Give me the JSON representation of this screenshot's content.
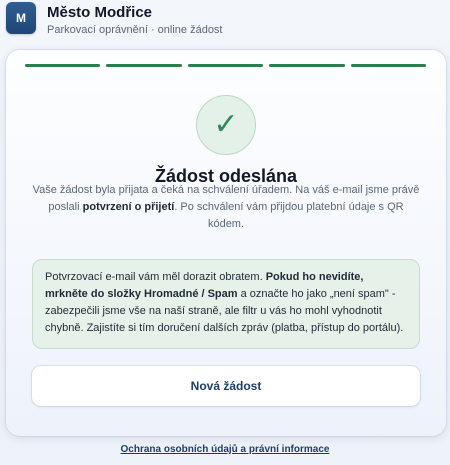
{
  "header": {
    "logo_letter": "M",
    "title": "Město Modřice",
    "subtitle": "Parkovací oprávnění · online žádost"
  },
  "steps": {
    "total": 5,
    "completed": 5
  },
  "success": {
    "check_glyph": "✓",
    "title": "Žádost odeslána",
    "desc_part1": "Vaše žádost byla přijata a čeká na schválení úřadem. Na váš e-mail jsme právě poslali ",
    "desc_bold": "potvrzení o přijetí",
    "desc_part2": ". Po schválení vám přijdou platební údaje s QR kódem."
  },
  "notice": {
    "part1": "Potvrzovací e-mail vám měl dorazit obratem. ",
    "bold": "Pokud ho nevidíte, mrkněte do složky Hromadné / Spam",
    "part2": " a označte ho jako „není spam\" - zabezpečili jsme vše na naší straně, ale filtr u vás ho mohl vyhodnotit chybně. Zajistíte si tím doručení dalších zpráv (platba, přístup do portálu)."
  },
  "actions": {
    "new_request_label": "Nová žádost"
  },
  "footer": {
    "link_label": "Ochrana osobních údajů a právní informace"
  },
  "colors": {
    "accent": "#2e7d4f",
    "primary": "#1e3e66",
    "notice_bg": "#e6f1ea"
  }
}
